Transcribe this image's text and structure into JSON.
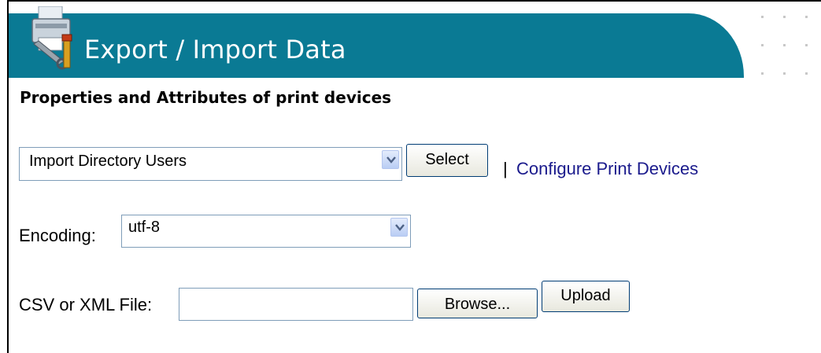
{
  "header": {
    "title": "Export / Import Data"
  },
  "section": {
    "heading": "Properties and Attributes of print devices"
  },
  "action_row": {
    "action_select_value": "Import Directory Users",
    "select_button_label": "Select",
    "separator": "|",
    "configure_link_label": "Configure Print Devices"
  },
  "encoding_row": {
    "label": "Encoding:",
    "value": "utf-8"
  },
  "file_row": {
    "label": "CSV or XML File:",
    "file_value": "",
    "browse_label": "Browse...",
    "upload_label": "Upload"
  },
  "colors": {
    "header_band": "#0a7a94",
    "link": "#1a1a8c"
  },
  "icons": [
    "printer-tools-icon",
    "chevron-down-icon"
  ]
}
